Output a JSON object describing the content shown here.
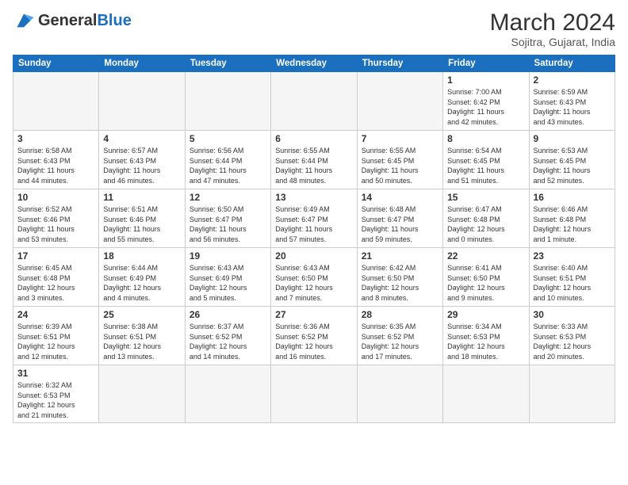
{
  "header": {
    "logo_general": "General",
    "logo_blue": "Blue",
    "month_year": "March 2024",
    "location": "Sojitra, Gujarat, India"
  },
  "weekdays": [
    "Sunday",
    "Monday",
    "Tuesday",
    "Wednesday",
    "Thursday",
    "Friday",
    "Saturday"
  ],
  "weeks": [
    [
      {
        "day": "",
        "empty": true
      },
      {
        "day": "",
        "empty": true
      },
      {
        "day": "",
        "empty": true
      },
      {
        "day": "",
        "empty": true
      },
      {
        "day": "",
        "empty": true
      },
      {
        "day": "1",
        "info": "Sunrise: 7:00 AM\nSunset: 6:42 PM\nDaylight: 11 hours\nand 42 minutes."
      },
      {
        "day": "2",
        "info": "Sunrise: 6:59 AM\nSunset: 6:43 PM\nDaylight: 11 hours\nand 43 minutes."
      }
    ],
    [
      {
        "day": "3",
        "info": "Sunrise: 6:58 AM\nSunset: 6:43 PM\nDaylight: 11 hours\nand 44 minutes."
      },
      {
        "day": "4",
        "info": "Sunrise: 6:57 AM\nSunset: 6:43 PM\nDaylight: 11 hours\nand 46 minutes."
      },
      {
        "day": "5",
        "info": "Sunrise: 6:56 AM\nSunset: 6:44 PM\nDaylight: 11 hours\nand 47 minutes."
      },
      {
        "day": "6",
        "info": "Sunrise: 6:55 AM\nSunset: 6:44 PM\nDaylight: 11 hours\nand 48 minutes."
      },
      {
        "day": "7",
        "info": "Sunrise: 6:55 AM\nSunset: 6:45 PM\nDaylight: 11 hours\nand 50 minutes."
      },
      {
        "day": "8",
        "info": "Sunrise: 6:54 AM\nSunset: 6:45 PM\nDaylight: 11 hours\nand 51 minutes."
      },
      {
        "day": "9",
        "info": "Sunrise: 6:53 AM\nSunset: 6:45 PM\nDaylight: 11 hours\nand 52 minutes."
      }
    ],
    [
      {
        "day": "10",
        "info": "Sunrise: 6:52 AM\nSunset: 6:46 PM\nDaylight: 11 hours\nand 53 minutes."
      },
      {
        "day": "11",
        "info": "Sunrise: 6:51 AM\nSunset: 6:46 PM\nDaylight: 11 hours\nand 55 minutes."
      },
      {
        "day": "12",
        "info": "Sunrise: 6:50 AM\nSunset: 6:47 PM\nDaylight: 11 hours\nand 56 minutes."
      },
      {
        "day": "13",
        "info": "Sunrise: 6:49 AM\nSunset: 6:47 PM\nDaylight: 11 hours\nand 57 minutes."
      },
      {
        "day": "14",
        "info": "Sunrise: 6:48 AM\nSunset: 6:47 PM\nDaylight: 11 hours\nand 59 minutes."
      },
      {
        "day": "15",
        "info": "Sunrise: 6:47 AM\nSunset: 6:48 PM\nDaylight: 12 hours\nand 0 minutes."
      },
      {
        "day": "16",
        "info": "Sunrise: 6:46 AM\nSunset: 6:48 PM\nDaylight: 12 hours\nand 1 minute."
      }
    ],
    [
      {
        "day": "17",
        "info": "Sunrise: 6:45 AM\nSunset: 6:48 PM\nDaylight: 12 hours\nand 3 minutes."
      },
      {
        "day": "18",
        "info": "Sunrise: 6:44 AM\nSunset: 6:49 PM\nDaylight: 12 hours\nand 4 minutes."
      },
      {
        "day": "19",
        "info": "Sunrise: 6:43 AM\nSunset: 6:49 PM\nDaylight: 12 hours\nand 5 minutes."
      },
      {
        "day": "20",
        "info": "Sunrise: 6:43 AM\nSunset: 6:50 PM\nDaylight: 12 hours\nand 7 minutes."
      },
      {
        "day": "21",
        "info": "Sunrise: 6:42 AM\nSunset: 6:50 PM\nDaylight: 12 hours\nand 8 minutes."
      },
      {
        "day": "22",
        "info": "Sunrise: 6:41 AM\nSunset: 6:50 PM\nDaylight: 12 hours\nand 9 minutes."
      },
      {
        "day": "23",
        "info": "Sunrise: 6:40 AM\nSunset: 6:51 PM\nDaylight: 12 hours\nand 10 minutes."
      }
    ],
    [
      {
        "day": "24",
        "info": "Sunrise: 6:39 AM\nSunset: 6:51 PM\nDaylight: 12 hours\nand 12 minutes."
      },
      {
        "day": "25",
        "info": "Sunrise: 6:38 AM\nSunset: 6:51 PM\nDaylight: 12 hours\nand 13 minutes."
      },
      {
        "day": "26",
        "info": "Sunrise: 6:37 AM\nSunset: 6:52 PM\nDaylight: 12 hours\nand 14 minutes."
      },
      {
        "day": "27",
        "info": "Sunrise: 6:36 AM\nSunset: 6:52 PM\nDaylight: 12 hours\nand 16 minutes."
      },
      {
        "day": "28",
        "info": "Sunrise: 6:35 AM\nSunset: 6:52 PM\nDaylight: 12 hours\nand 17 minutes."
      },
      {
        "day": "29",
        "info": "Sunrise: 6:34 AM\nSunset: 6:53 PM\nDaylight: 12 hours\nand 18 minutes."
      },
      {
        "day": "30",
        "info": "Sunrise: 6:33 AM\nSunset: 6:53 PM\nDaylight: 12 hours\nand 20 minutes."
      }
    ],
    [
      {
        "day": "31",
        "info": "Sunrise: 6:32 AM\nSunset: 6:53 PM\nDaylight: 12 hours\nand 21 minutes."
      },
      {
        "day": "",
        "empty": true
      },
      {
        "day": "",
        "empty": true
      },
      {
        "day": "",
        "empty": true
      },
      {
        "day": "",
        "empty": true
      },
      {
        "day": "",
        "empty": true
      },
      {
        "day": "",
        "empty": true
      }
    ]
  ]
}
